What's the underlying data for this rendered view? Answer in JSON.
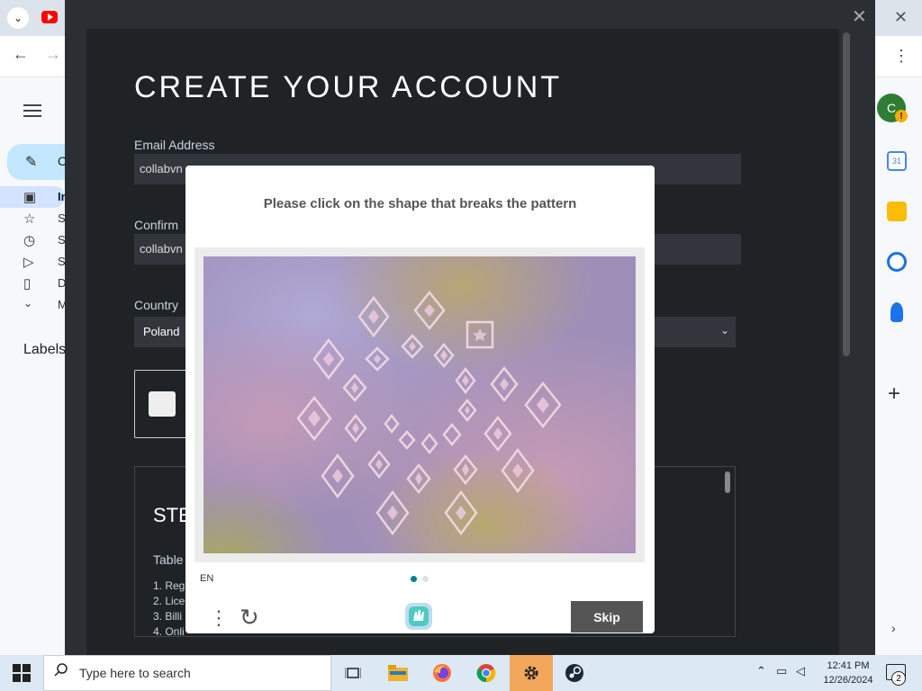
{
  "browser": {
    "tabs_chevron": "⌄",
    "close_label": "✕",
    "back_label": "←",
    "forward_label": "→",
    "more_label": "⋮"
  },
  "gmail": {
    "compose_letter": "C",
    "nav_items": [
      {
        "letter": "In",
        "icon": "inbox-icon"
      },
      {
        "letter": "S",
        "icon": "star-icon"
      },
      {
        "letter": "S",
        "icon": "clock-icon"
      },
      {
        "letter": "S",
        "icon": "send-icon"
      },
      {
        "letter": "D",
        "icon": "draft-icon"
      },
      {
        "letter": "M",
        "icon": "chevron-down-icon"
      }
    ],
    "labels_title": "Labels",
    "avatar_letter": "C",
    "calendar_day": "31"
  },
  "steam": {
    "title": "CREATE YOUR ACCOUNT",
    "email_label": "Email Address",
    "email_value": "collabvn",
    "confirm_label": "Confirm",
    "confirm_value": "collabvn",
    "country_label": "Country",
    "country_value": "Poland",
    "ssa_title": "STE",
    "ssa_toc": "Table",
    "ssa_items": [
      "1. Reg",
      "2. Lice",
      "3. Billi",
      "4. Onli"
    ]
  },
  "captcha": {
    "prompt": "Please click on the shape that breaks the pattern",
    "language": "EN",
    "skip_label": "Skip",
    "page": 1,
    "pages": 2
  },
  "taskbar": {
    "search_placeholder": "Type here to search",
    "time": "12:41 PM",
    "date": "12/26/2024",
    "notification_count": "2",
    "apps": [
      "task-view-icon",
      "file-explorer-icon",
      "firefox-icon",
      "chrome-icon",
      "settings-icon",
      "steam-icon"
    ],
    "active_app": "settings-icon"
  }
}
